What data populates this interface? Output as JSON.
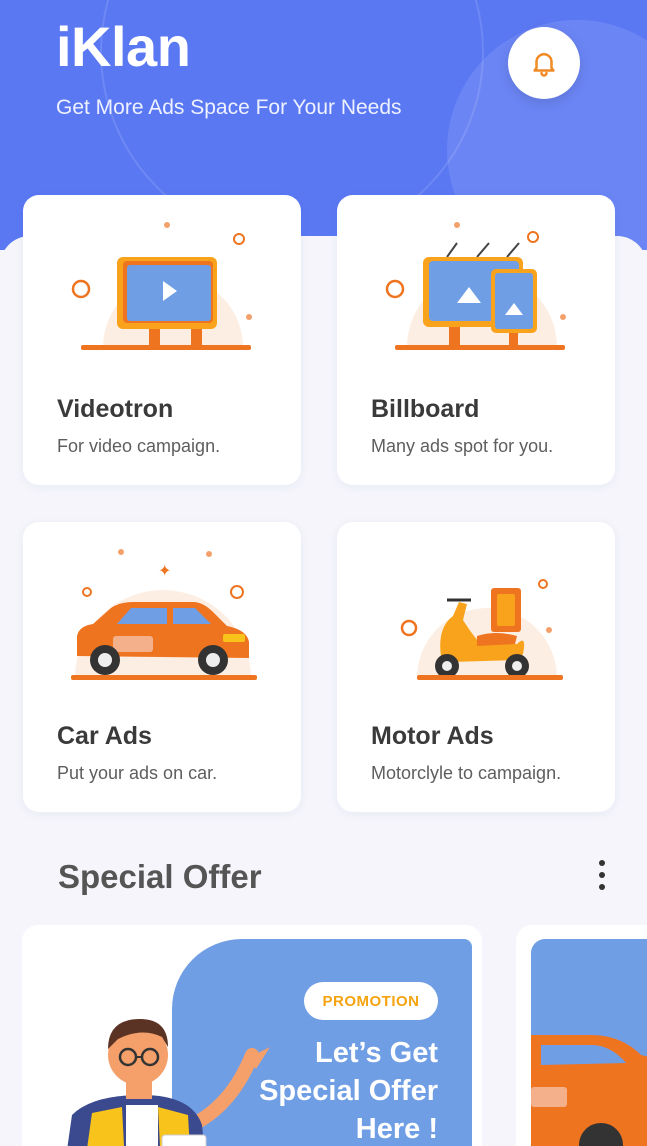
{
  "header": {
    "title": "iKlan",
    "subtitle": "Get More Ads Space For Your Needs",
    "notification_icon": "bell-icon"
  },
  "categories": [
    {
      "title": "Videotron",
      "description": "For video campaign.",
      "icon": "videotron-illustration"
    },
    {
      "title": "Billboard",
      "description": "Many ads spot for you.",
      "icon": "billboard-illustration"
    },
    {
      "title": "Car Ads",
      "description": "Put your ads on car.",
      "icon": "car-illustration"
    },
    {
      "title": "Motor Ads",
      "description": "Motorclyle to campaign.",
      "icon": "scooter-illustration"
    }
  ],
  "special_offer": {
    "title": "Special Offer",
    "menu_icon": "more-vertical-icon",
    "promos": [
      {
        "badge": "PROMOTION",
        "lines": [
          "Let’s Get",
          "Special Offer",
          "Here !"
        ]
      }
    ]
  },
  "colors": {
    "primary": "#5b78f3",
    "accent": "#f5a30f",
    "orange": "#ee7420",
    "promo_blue": "#6f9ee5"
  }
}
